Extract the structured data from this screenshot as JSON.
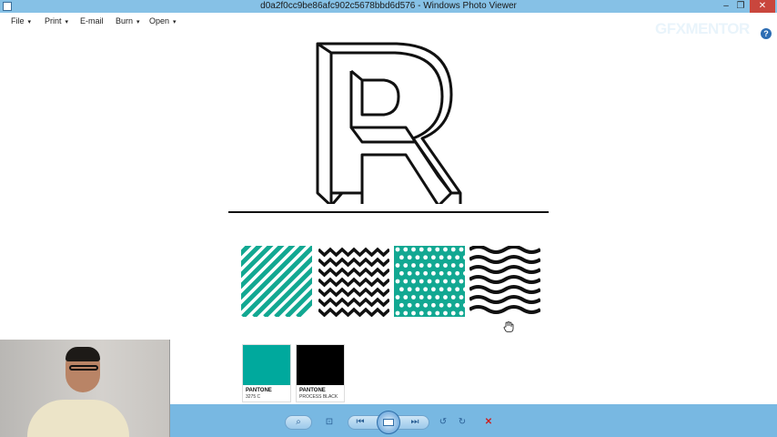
{
  "window": {
    "title": "d0a2f0cc9be86afc902c5678bbd6d576 - Windows Photo Viewer",
    "minimize_glyph": "–",
    "restore_glyph": "❐",
    "close_glyph": "✕"
  },
  "menu": {
    "items": [
      {
        "label": "File",
        "has_dropdown": true
      },
      {
        "label": "Print",
        "has_dropdown": true
      },
      {
        "label": "E-mail",
        "has_dropdown": false
      },
      {
        "label": "Burn",
        "has_dropdown": true
      },
      {
        "label": "Open",
        "has_dropdown": true
      }
    ],
    "help_glyph": "?"
  },
  "overlay": {
    "brand": "GFXMENTOR"
  },
  "image": {
    "logo_letter": "R",
    "patterns": [
      {
        "name": "diagonal-stripes",
        "color": "#12a892"
      },
      {
        "name": "zigzag",
        "color": "#111111"
      },
      {
        "name": "dots",
        "color": "#12a892"
      },
      {
        "name": "waves",
        "color": "#111111"
      }
    ],
    "swatches": [
      {
        "brand": "PANTONE",
        "code": "3275 C",
        "color": "#00a99d"
      },
      {
        "brand": "PANTONE",
        "code": "PROCESS BLACK",
        "color": "#000000"
      }
    ]
  },
  "toolbar": {
    "zoom_glyph": "⌕",
    "fit_glyph": "⊡",
    "previous_glyph": "⏮",
    "next_glyph": "⏭",
    "rotate_ccw_glyph": "↺",
    "rotate_cw_glyph": "↻",
    "delete_glyph": "✕"
  },
  "colors": {
    "titlebar": "#86c1e6",
    "taskbar": "#78b8e2",
    "teal": "#12a892",
    "black": "#111111"
  }
}
